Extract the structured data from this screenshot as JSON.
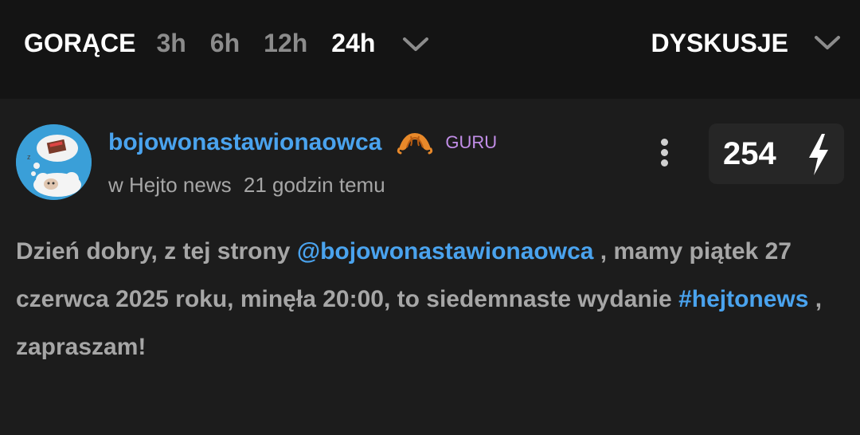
{
  "header": {
    "sort_label": "GORĄCE",
    "time_filters": [
      "3h",
      "6h",
      "12h",
      "24h"
    ],
    "active_filter": "24h",
    "section_label": "DYSKUSJE"
  },
  "post": {
    "username": "bojowonastawionaowca",
    "rank": "GURU",
    "community_prefix": "w",
    "community": "Hejto news",
    "time": "21 godzin temu",
    "votes": "254",
    "content": {
      "part1": "Dzień dobry, z tej strony ",
      "mention": "@bojowonastawionaowca",
      "part2": " , mamy piątek 27 czerwca 2025 roku, minęła 20:00, to siedemnaste wydanie ",
      "tag": "#hejtonews",
      "part3": " , zapraszam!"
    }
  },
  "colors": {
    "background": "#1c1c1c",
    "topbar": "#141414",
    "link": "#4aa3ee",
    "rank": "#c28ee8",
    "muted_text": "#a6a6a6"
  },
  "icons": [
    "chevron-down-icon",
    "croissant-icon",
    "more-vertical-icon",
    "lightning-bolt-icon",
    "avatar-sheep-image"
  ]
}
